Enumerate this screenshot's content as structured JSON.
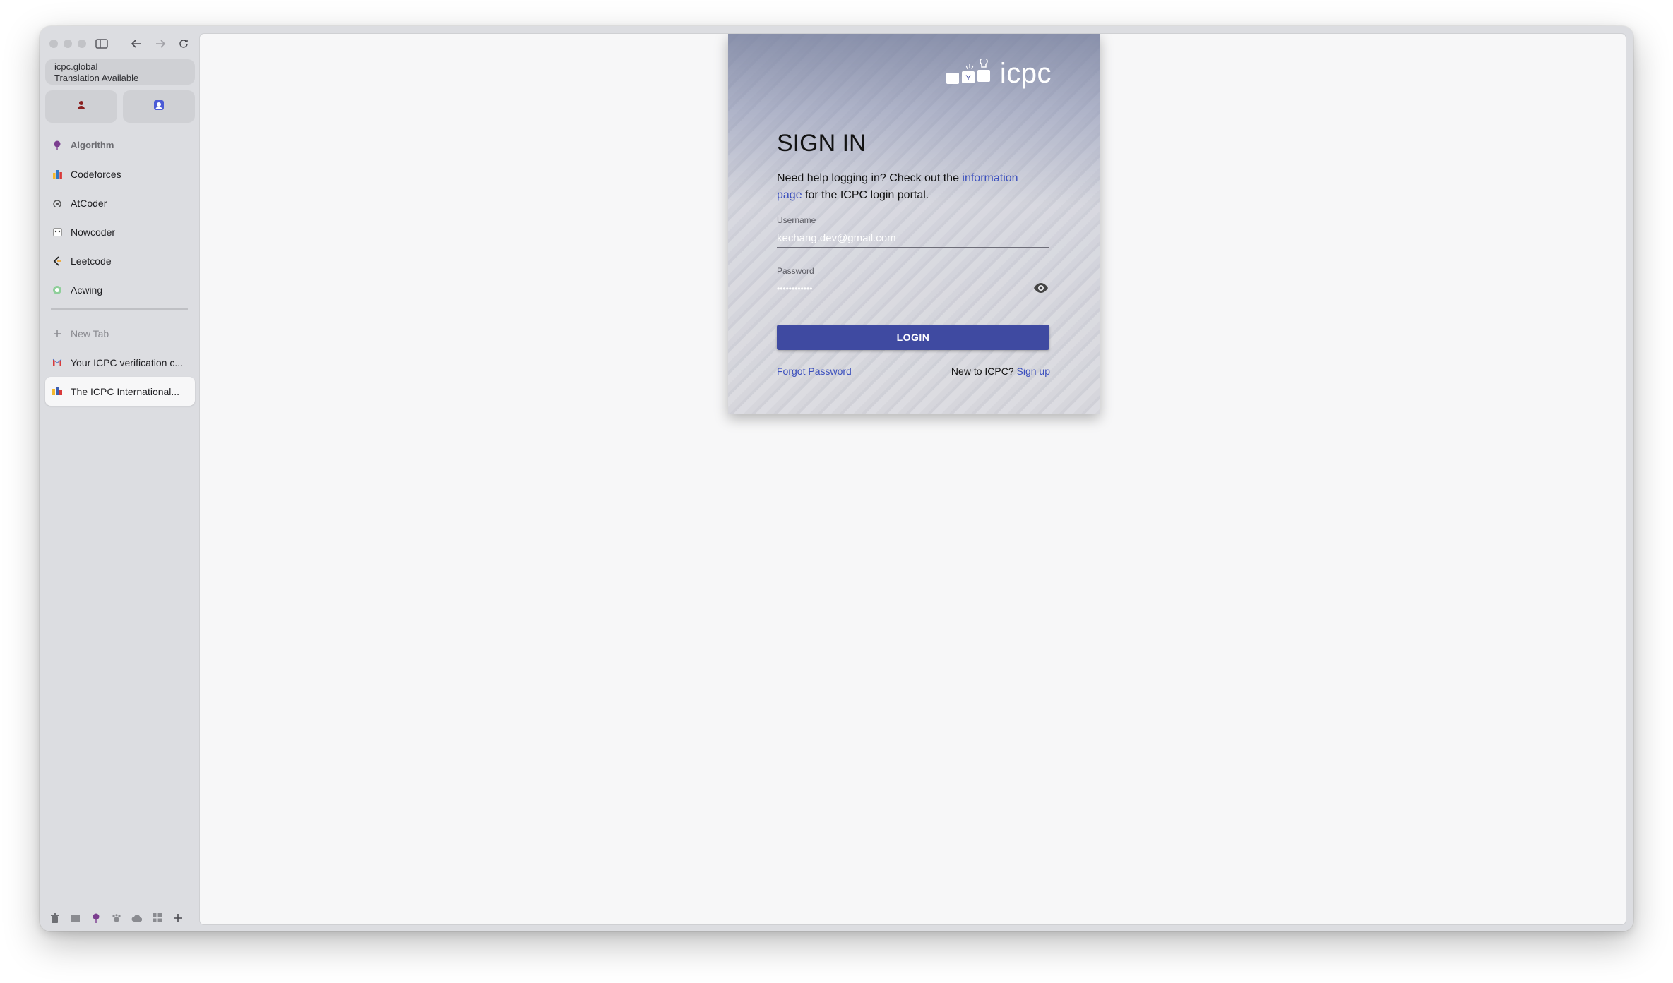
{
  "browser": {
    "address": {
      "domain": "icpc.global",
      "status": "Translation Available"
    },
    "favorites": [
      {
        "label": "Algorithm",
        "icon": "pin-icon",
        "color": "#7b3d8f",
        "is_folder": true
      },
      {
        "label": "Codeforces",
        "icon": "codeforces-icon",
        "color": "#e2a632"
      },
      {
        "label": "AtCoder",
        "icon": "atcoder-icon",
        "color": "#555555"
      },
      {
        "label": "Nowcoder",
        "icon": "nowcoder-icon",
        "color": "#888888"
      },
      {
        "label": "Leetcode",
        "icon": "leetcode-icon",
        "color": "#222222"
      },
      {
        "label": "Acwing",
        "icon": "acwing-icon",
        "color": "#59a86b"
      }
    ],
    "new_tab_label": "New Tab",
    "tabs": [
      {
        "label": "Your ICPC verification c...",
        "icon": "gmail-icon"
      },
      {
        "label": "The ICPC International...",
        "icon": "icpc-icon",
        "active": true
      }
    ]
  },
  "page": {
    "logo_text": "icpc",
    "title": "SIGN IN",
    "help": {
      "prefix": "Need help logging in? Check out the ",
      "link": "information page",
      "suffix": " for the ICPC login portal."
    },
    "username": {
      "label": "Username",
      "value": "kechang.dev@gmail.com"
    },
    "password": {
      "label": "Password",
      "value": "••••••••••••"
    },
    "login_button": "LOGIN",
    "forgot_password": "Forgot Password",
    "signup_prompt": "New to ICPC?",
    "signup_link": "Sign up",
    "colors": {
      "accent": "#3f4aa1",
      "link": "#3b4fbd"
    }
  }
}
